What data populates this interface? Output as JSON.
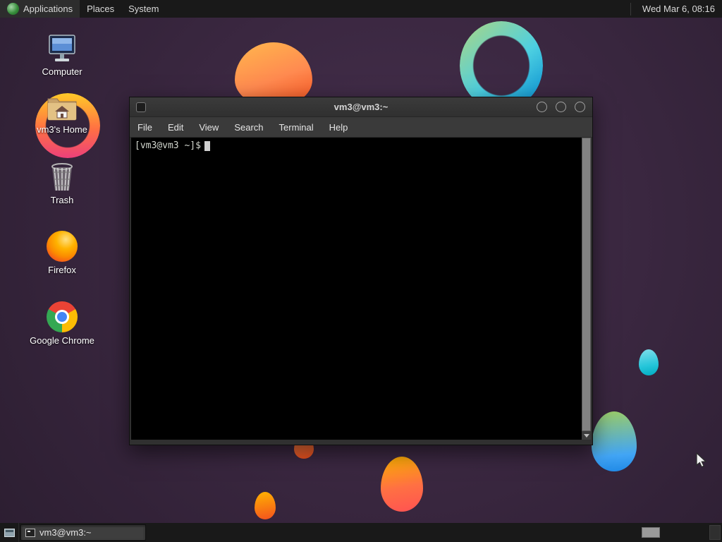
{
  "top_panel": {
    "menus": [
      {
        "label": "Applications"
      },
      {
        "label": "Places"
      },
      {
        "label": "System"
      }
    ],
    "clock": "Wed Mar 6, 08:16"
  },
  "desktop_icons": [
    {
      "label": "Computer",
      "icon": "computer-icon"
    },
    {
      "label": "vm3's Home",
      "icon": "home-folder-icon"
    },
    {
      "label": "Trash",
      "icon": "trash-icon"
    },
    {
      "label": "Firefox",
      "icon": "firefox-icon"
    },
    {
      "label": "Google Chrome",
      "icon": "chrome-icon"
    }
  ],
  "terminal_window": {
    "title": "vm3@vm3:~",
    "menu_items": [
      "File",
      "Edit",
      "View",
      "Search",
      "Terminal",
      "Help"
    ],
    "prompt": "[vm3@vm3 ~]$"
  },
  "taskbar": {
    "window_label": "vm3@vm3:~"
  },
  "colors": {
    "desktop_bg": "#3a2740",
    "panel_bg": "#191919",
    "window_chrome": "#353535",
    "terminal_bg": "#000000",
    "terminal_text": "#d3d7cf"
  }
}
